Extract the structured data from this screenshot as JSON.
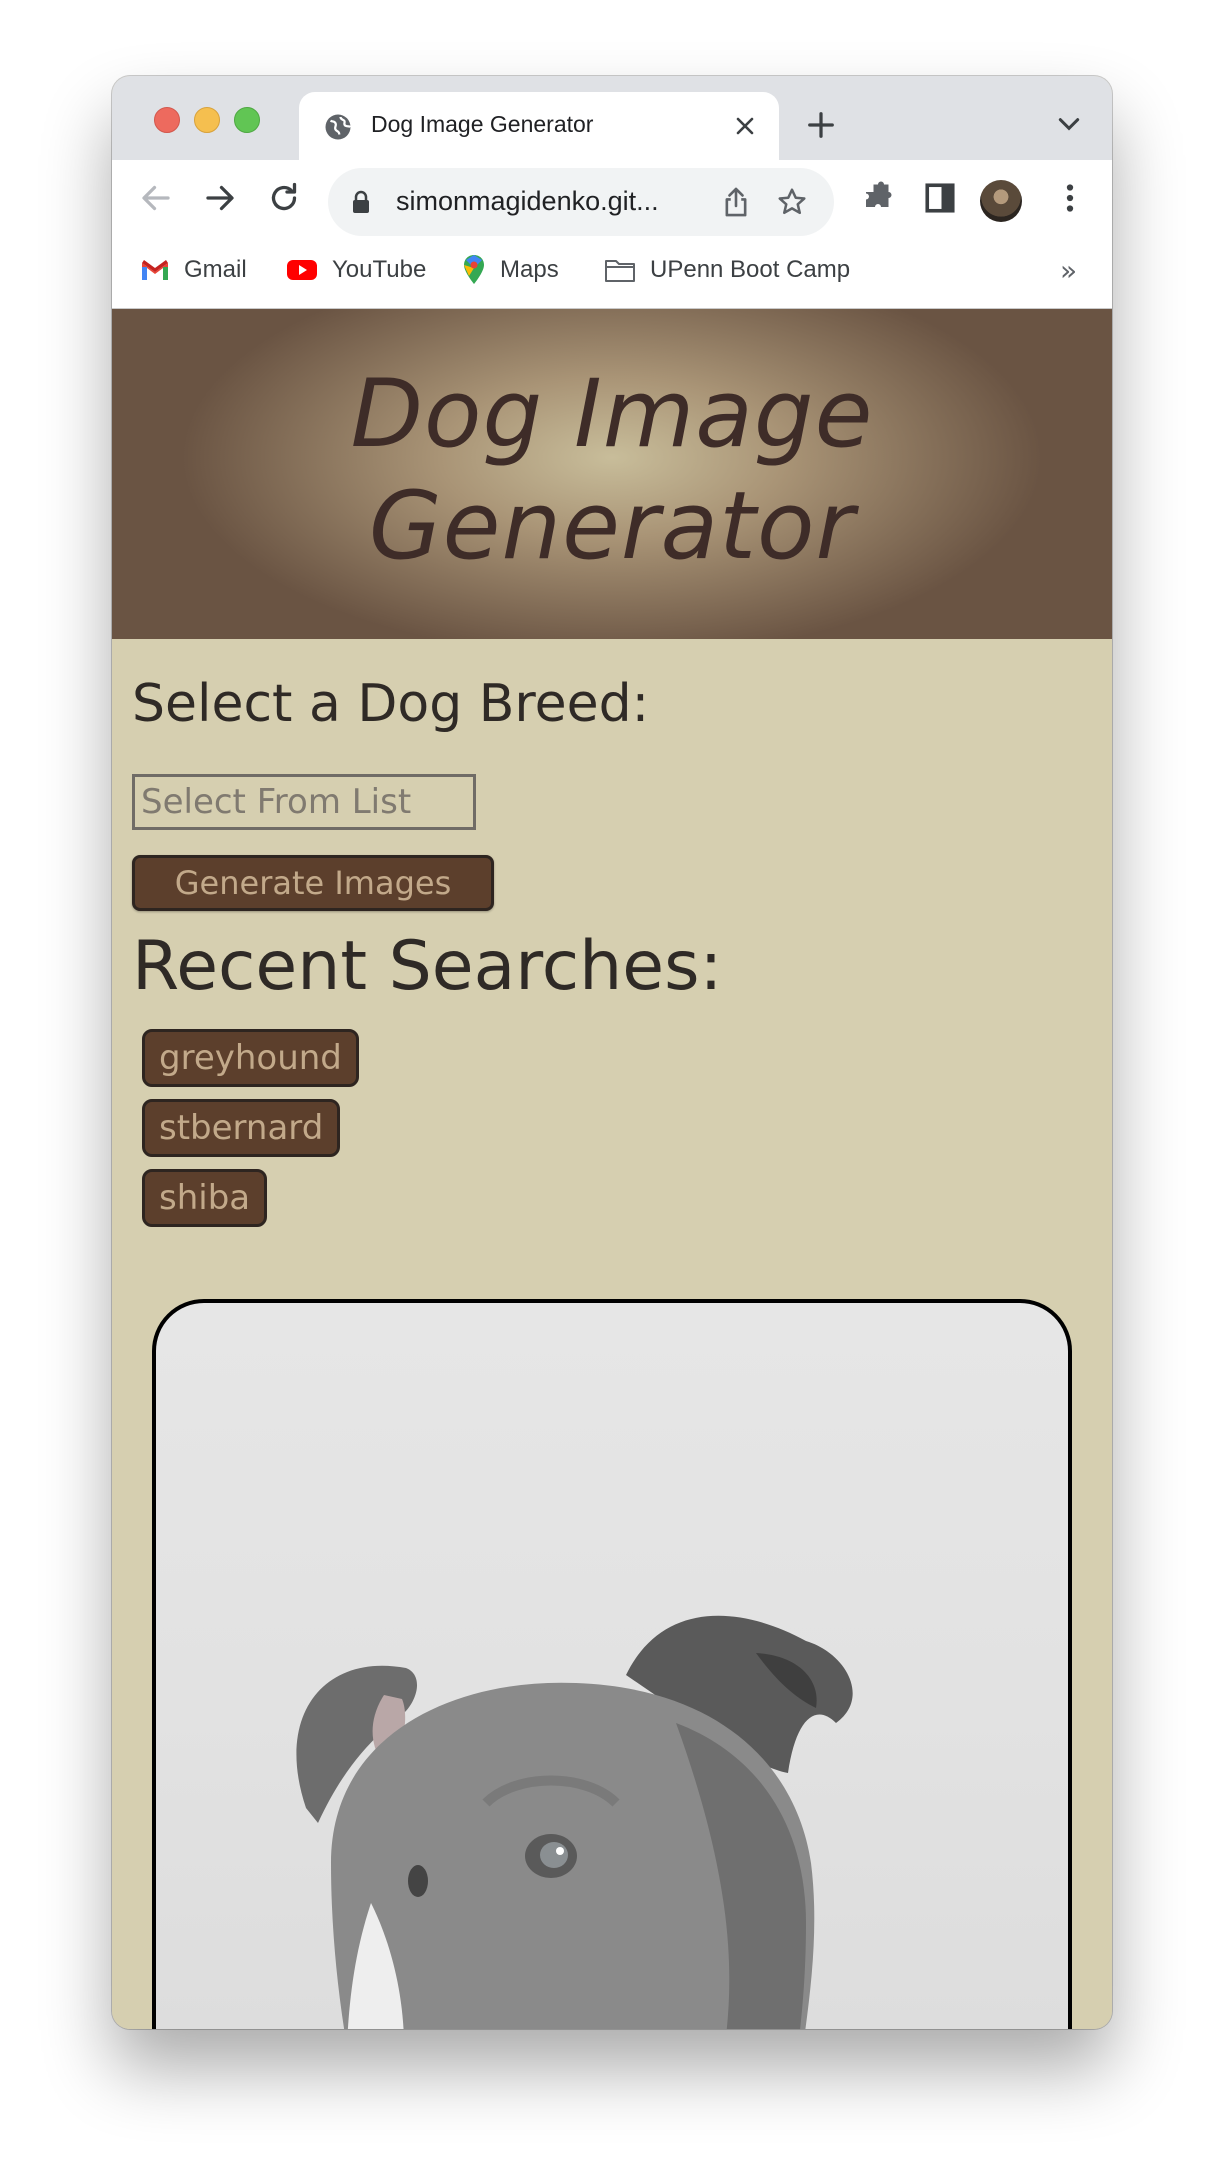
{
  "browser": {
    "tab": {
      "title": "Dog Image Generator",
      "icon": "globe-icon"
    },
    "url": "simonmagidenko.git...",
    "bookmarks": [
      {
        "label": "Gmail",
        "icon": "gmail-icon"
      },
      {
        "label": "YouTube",
        "icon": "youtube-icon"
      },
      {
        "label": "Maps",
        "icon": "maps-icon"
      },
      {
        "label": "UPenn Boot Camp",
        "icon": "folder-icon"
      }
    ],
    "more_bookmarks": "»"
  },
  "page": {
    "hero_title_line1": "Dog Image",
    "hero_title_line2": "Generator",
    "select_label": "Select a Dog Breed:",
    "select_placeholder": "Select From List",
    "generate_button": "Generate Images",
    "recent_title": "Recent Searches:",
    "recent_searches": [
      "greyhound",
      "stbernard",
      "shiba"
    ]
  },
  "colors": {
    "page_background": "#d6cfb0",
    "button_background": "#5c3f2c",
    "button_text": "#c2a98a",
    "heading_text": "#3e2c28"
  }
}
